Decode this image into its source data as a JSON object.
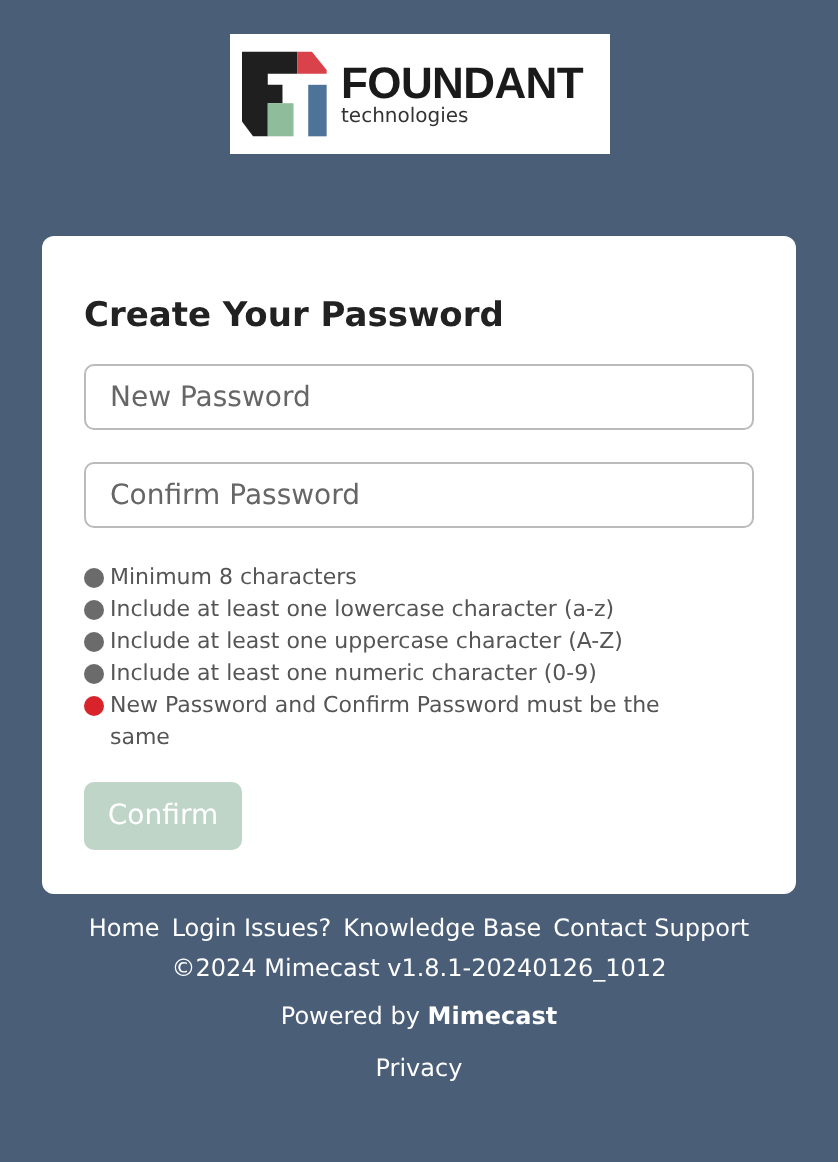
{
  "logo": {
    "name": "FOUNDANT",
    "tagline": "technologies"
  },
  "card": {
    "title": "Create Your Password",
    "fields": [
      {
        "placeholder": "New Password"
      },
      {
        "placeholder": "Confirm Password"
      }
    ],
    "rules": [
      {
        "text": "Minimum 8 characters",
        "color": "#6b6b6b"
      },
      {
        "text": "Include at least one lowercase character (a-z)",
        "color": "#6b6b6b"
      },
      {
        "text": "Include at least one uppercase character (A-Z)",
        "color": "#6b6b6b"
      },
      {
        "text": "Include at least one numeric character (0-9)",
        "color": "#6b6b6b"
      },
      {
        "text": "New Password and Confirm Password must be the same",
        "color": "#d9232a"
      }
    ],
    "button": {
      "label": "Confirm",
      "disabled": true
    }
  },
  "footer": {
    "links": [
      "Home",
      "Login Issues?",
      "Knowledge Base",
      "Contact Support"
    ],
    "copyright": "©2024 Mimecast v1.8.1-20240126_1012",
    "powered": "Powered by **Mimecast**",
    "privacy": "Privacy"
  }
}
